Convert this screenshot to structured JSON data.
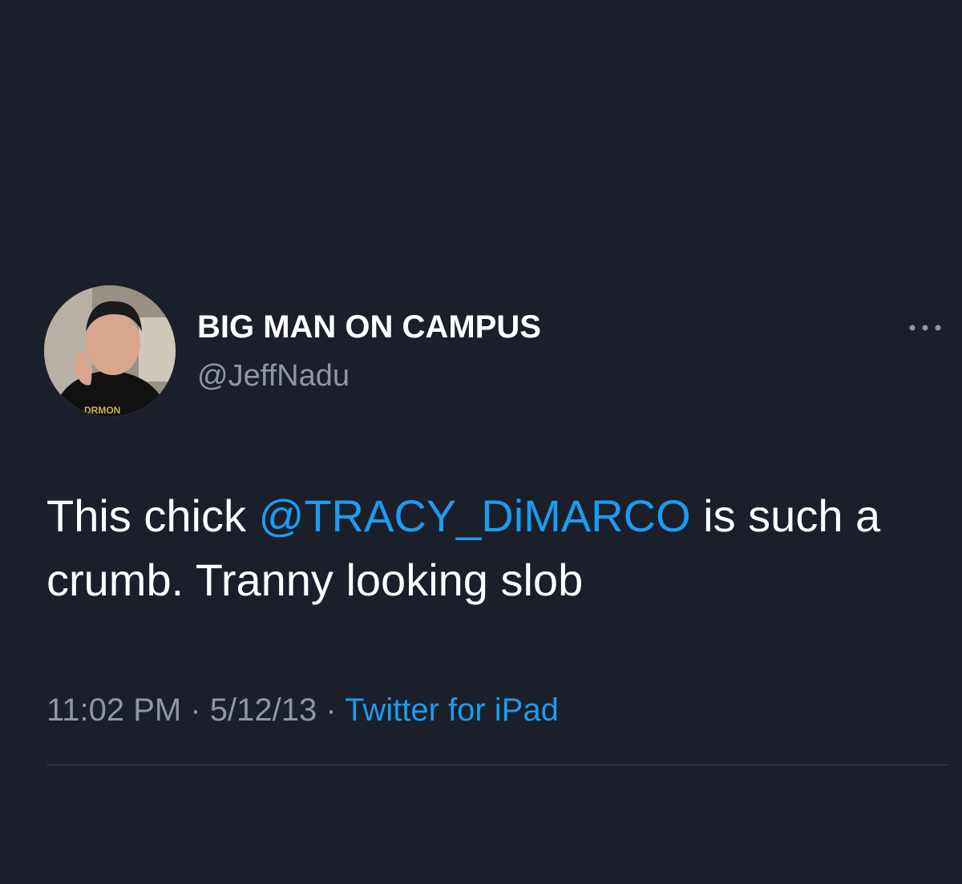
{
  "tweet": {
    "author": {
      "display_name": "BIG MAN ON CAMPUS",
      "handle": "@JeffNadu"
    },
    "more_icon": "ellipsis-icon",
    "text": {
      "before": "This chick ",
      "mention": "@TRACY_DiMARCO",
      "after": " is such a crumb. Tranny looking slob"
    },
    "meta": {
      "time": "11:02 PM",
      "separator_1": " · ",
      "date": "5/12/13",
      "separator_2": " · ",
      "source": "Twitter for iPad"
    }
  },
  "colors": {
    "background": "#1a1f2a",
    "primary_text": "#ffffff",
    "secondary_text": "#8b98a5",
    "link": "#1d9bf0"
  }
}
